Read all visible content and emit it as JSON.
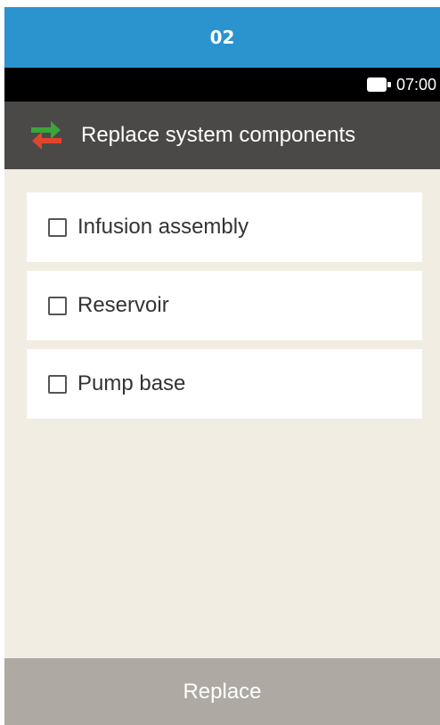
{
  "banner": {
    "text": "02",
    "color": "#2b93cd"
  },
  "status": {
    "battery_icon": "battery-icon",
    "time": "07:00"
  },
  "header": {
    "icon": "swap-arrows-icon",
    "title": "Replace system components",
    "background": "#4a4948"
  },
  "items": [
    {
      "label": "Infusion assembly",
      "checked": false
    },
    {
      "label": "Reservoir",
      "checked": false
    },
    {
      "label": "Pump base",
      "checked": false
    }
  ],
  "action": {
    "label": "Replace",
    "background": "#aeaaa3"
  },
  "colors": {
    "banner": "#2b93cd",
    "background": "#f1ede3",
    "arrow_green": "#3aa53a",
    "arrow_red": "#e0452b"
  }
}
